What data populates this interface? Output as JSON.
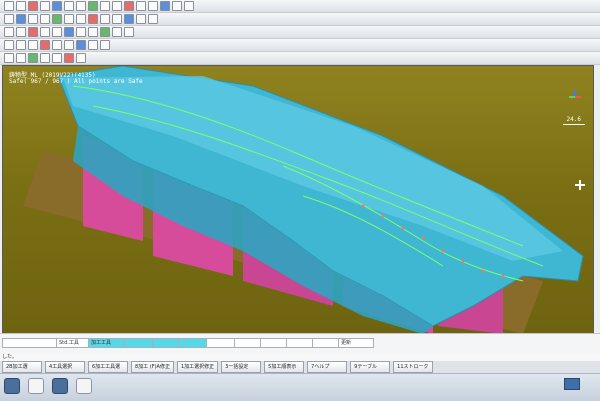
{
  "viewport": {
    "title_line": "鋳物型_ML (2019V22)(4135)",
    "check_line": "Safe( 967 / 967 ) All points are Safe",
    "zoom_value": "24.6",
    "axis_icon": "xyz-axis-icon",
    "cursor_icon": "crosshair-icon",
    "colors": {
      "background": "#7f7318",
      "part_surface": "#3fb6d2",
      "fixture": "#d64c9a",
      "toolpath": "#7dff6a",
      "points": "#ff6e6e"
    }
  },
  "statusbar": {
    "cells": [
      "",
      "Std.工具",
      "加工工具",
      "",
      "",
      "",
      "",
      "",
      "",
      "",
      "",
      "更新"
    ]
  },
  "status_line": "した。",
  "fkeys": [
    "2B加工選",
    "4工具選択",
    "6加工工具選",
    "8加工 (F)A修正",
    "1加工選択修正",
    "3一括設定",
    "5加工順表示",
    "7ヘルプ",
    "9テーブル",
    "11ストローク"
  ]
}
